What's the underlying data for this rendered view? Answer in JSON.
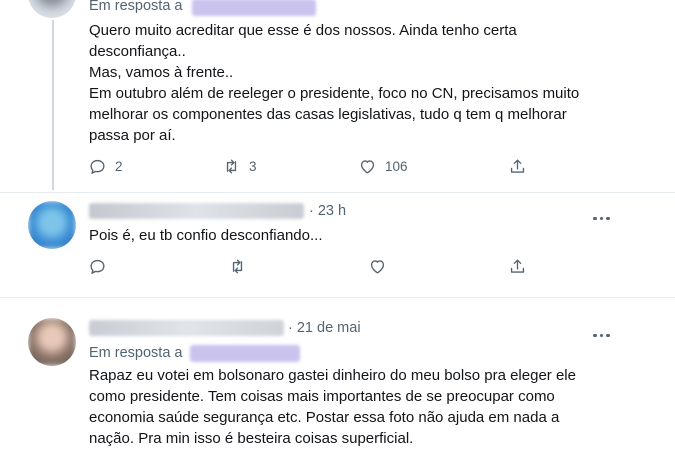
{
  "colors": {
    "text": "#111418",
    "muted": "#536471",
    "mention_blur": "#c9c3ee",
    "divider": "#e6ecf0",
    "thread_line": "#cfd9de"
  },
  "tweet1": {
    "reply_prefix": "Em resposta a",
    "text": "Quero muito acreditar que esse é dos nossos. Ainda tenho certa\ndesconfiança..\nMas, vamos à frente..\nEm outubro além de reeleger o presidente,  foco no CN, precisamos muito\nmelhorar os componentes das casas legislativas, tudo q tem q melhorar\npassa por aí.",
    "actions": {
      "reply_count": "2",
      "retweet_count": "3",
      "like_count": "106",
      "reply_icon": "reply-icon",
      "retweet_icon": "retweet-icon",
      "like_icon": "heart-icon",
      "share_icon": "share-icon"
    }
  },
  "tweet2": {
    "time": "· 23 h",
    "text": "Pois é, eu tb confio desconfiando...",
    "more_icon": "more-icon"
  },
  "tweet3": {
    "time": "· 21 de mai",
    "reply_prefix": "Em resposta a",
    "text": "Rapaz eu votei em bolsonaro gastei dinheiro do meu bolso pra eleger ele\ncomo presidente. Tem coisas mais importantes de se preocupar como\neconomia saúde segurança etc. Postar essa foto não ajuda em nada a\nnação. Pra min isso é besteira coisas superficial.",
    "more_icon": "more-icon"
  }
}
